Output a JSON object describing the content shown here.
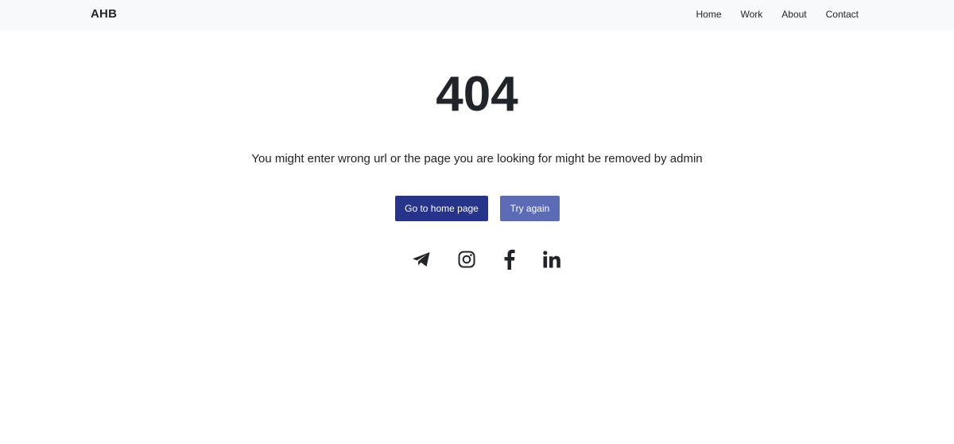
{
  "navbar": {
    "brand": "AHB",
    "links": [
      {
        "label": "Home"
      },
      {
        "label": "Work"
      },
      {
        "label": "About"
      },
      {
        "label": "Contact"
      }
    ]
  },
  "error": {
    "code": "404",
    "message": "You might enter wrong url or the page you are looking for might be removed by admin"
  },
  "actions": {
    "home_label": "Go to home page",
    "retry_label": "Try again"
  },
  "social": [
    {
      "icon": "telegram-icon"
    },
    {
      "icon": "instagram-icon"
    },
    {
      "icon": "facebook-icon"
    },
    {
      "icon": "linkedin-icon"
    }
  ],
  "colors": {
    "primary": "#27348b",
    "primary_light": "#5c6bb6",
    "navbar_bg": "#f8f9fa",
    "text": "#212529"
  }
}
